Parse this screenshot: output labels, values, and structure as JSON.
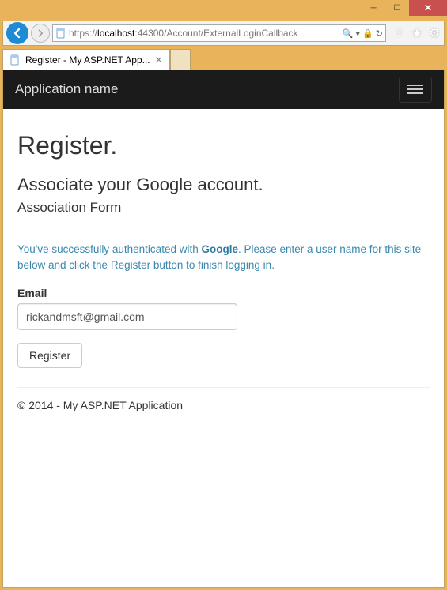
{
  "window": {
    "tab_title": "Register - My ASP.NET App...",
    "url_proto": "https://",
    "url_host": "localhost",
    "url_port": ":44300",
    "url_path": "/Account/ExternalLoginCallback"
  },
  "navbar": {
    "brand": "Application name"
  },
  "page": {
    "title": "Register.",
    "subtitle": "Associate your Google account.",
    "form_title": "Association Form",
    "info_prefix": "You've successfully authenticated with ",
    "info_provider": "Google",
    "info_suffix": ". Please enter a user name for this site below and click the Register button to finish logging in.",
    "email_label": "Email",
    "email_value": "rickandmsft@gmail.com",
    "register_label": "Register",
    "footer": "© 2014 - My ASP.NET Application"
  }
}
